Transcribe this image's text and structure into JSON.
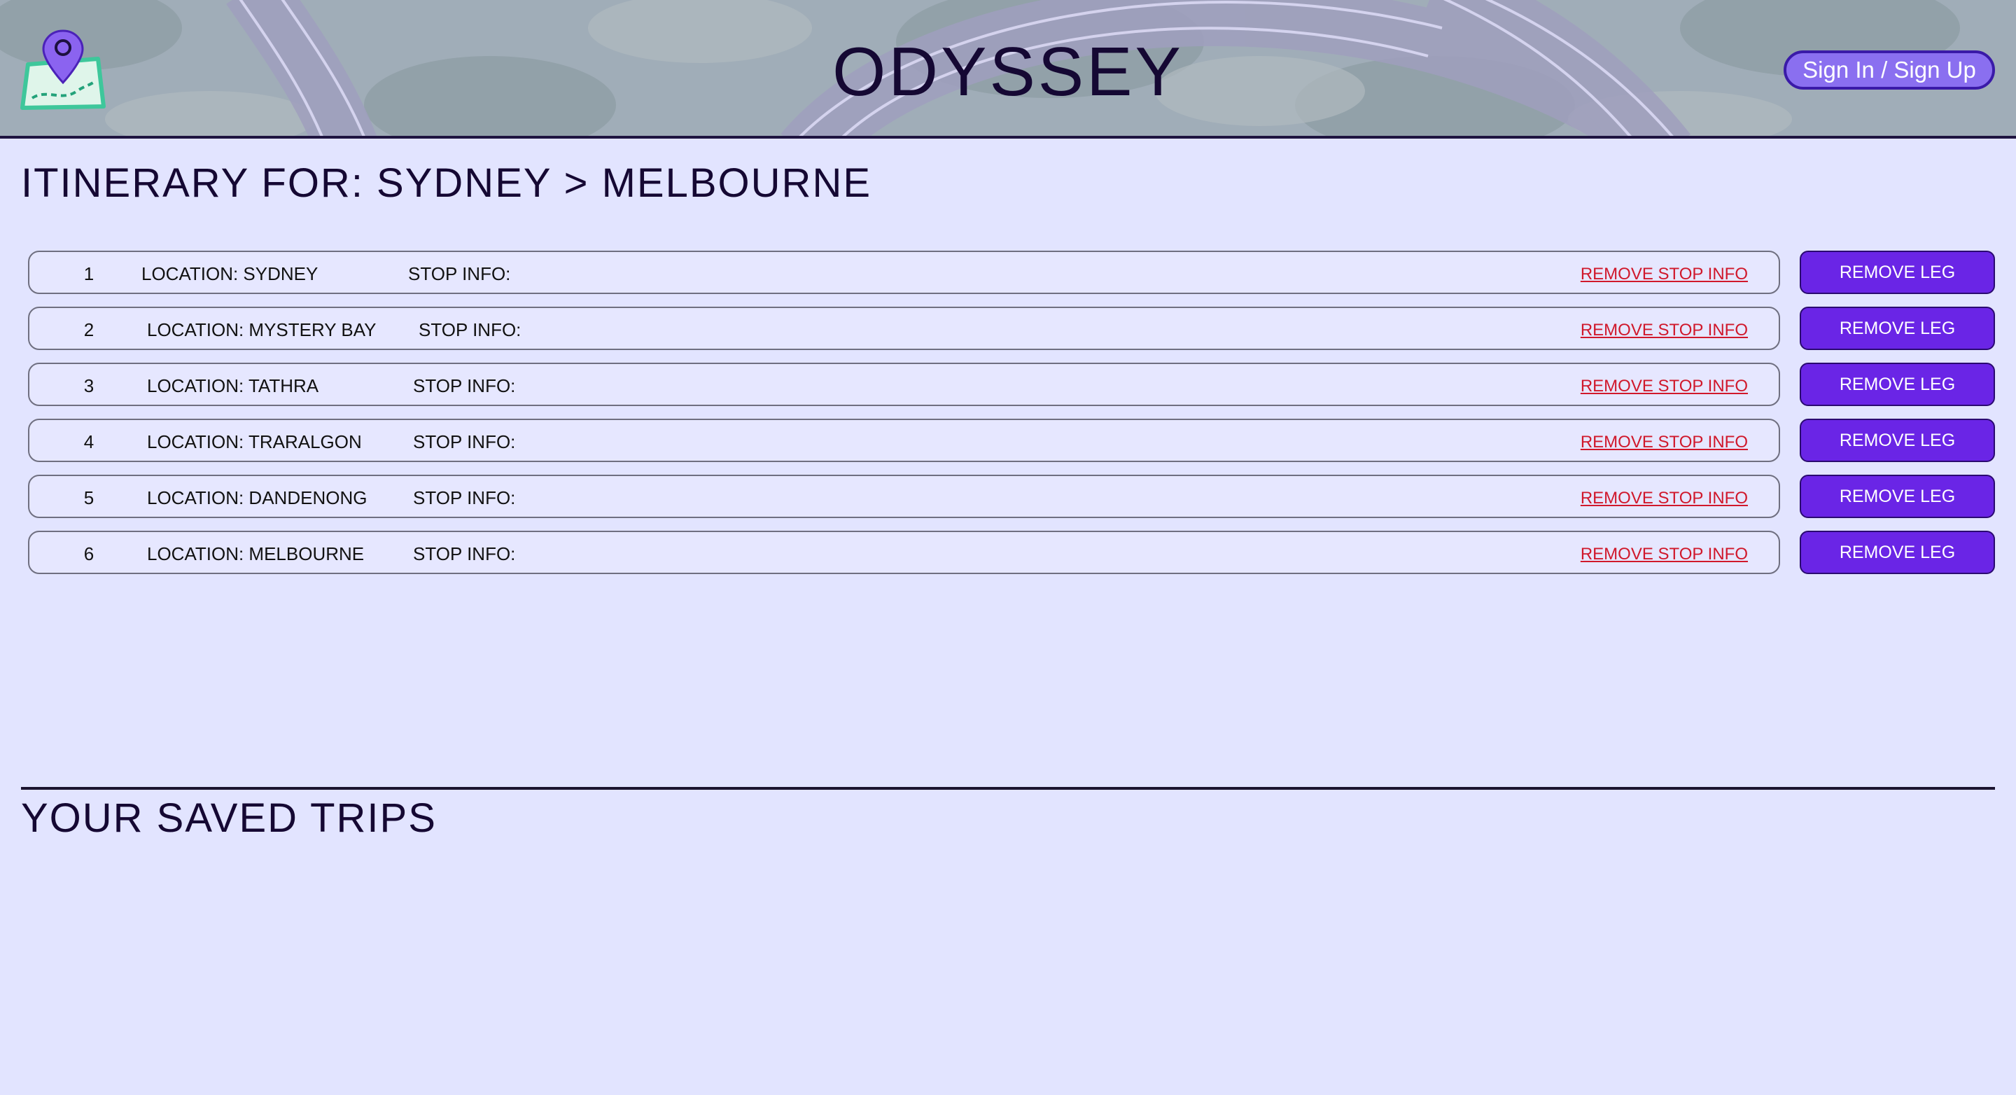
{
  "header": {
    "brand": "ODYSSEY",
    "signin_label": "Sign In / Sign Up",
    "logo_icon": "map-pin-icon",
    "colors": {
      "accent": "#6a25e6",
      "signin_bg": "#8a6ff0",
      "remove_link": "#d0182b"
    }
  },
  "itinerary": {
    "title": "ITINERARY FOR: SYDNEY > MELBOURNE",
    "legs": [
      {
        "num": "1",
        "location": "LOCATION: SYDNEY",
        "stop_info": "STOP INFO:",
        "remove_stop": "REMOVE STOP INFO",
        "remove_leg": "REMOVE LEG"
      },
      {
        "num": "2",
        "location": "LOCATION: MYSTERY BAY",
        "stop_info": "STOP INFO:",
        "remove_stop": "REMOVE STOP INFO",
        "remove_leg": "REMOVE LEG"
      },
      {
        "num": "3",
        "location": "LOCATION: TATHRA",
        "stop_info": "STOP INFO:",
        "remove_stop": "REMOVE STOP INFO",
        "remove_leg": "REMOVE LEG"
      },
      {
        "num": "4",
        "location": "LOCATION: TRARALGON",
        "stop_info": "STOP INFO:",
        "remove_stop": "REMOVE STOP INFO",
        "remove_leg": "REMOVE LEG"
      },
      {
        "num": "5",
        "location": "LOCATION: DANDENONG",
        "stop_info": "STOP INFO:",
        "remove_stop": "REMOVE STOP INFO",
        "remove_leg": "REMOVE LEG"
      },
      {
        "num": "6",
        "location": "LOCATION: MELBOURNE",
        "stop_info": "STOP INFO:",
        "remove_stop": "REMOVE STOP INFO",
        "remove_leg": "REMOVE LEG"
      }
    ]
  },
  "saved": {
    "title": "YOUR SAVED TRIPS"
  }
}
